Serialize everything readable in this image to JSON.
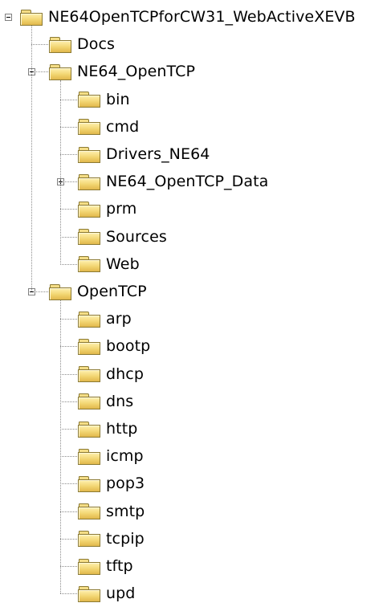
{
  "tree": {
    "root": {
      "label": "NE64OpenTCPforCW31_WebActiveXEVB",
      "expanded": true,
      "children": [
        {
          "label": "Docs"
        },
        {
          "label": "NE64_OpenTCP",
          "expanded": true,
          "children": [
            {
              "label": "bin"
            },
            {
              "label": "cmd"
            },
            {
              "label": "Drivers_NE64"
            },
            {
              "label": "NE64_OpenTCP_Data",
              "expanded": false,
              "has_children": true
            },
            {
              "label": "prm"
            },
            {
              "label": "Sources"
            },
            {
              "label": "Web"
            }
          ]
        },
        {
          "label": "OpenTCP",
          "expanded": true,
          "children": [
            {
              "label": "arp"
            },
            {
              "label": "bootp"
            },
            {
              "label": "dhcp"
            },
            {
              "label": "dns"
            },
            {
              "label": "http"
            },
            {
              "label": "icmp"
            },
            {
              "label": "pop3"
            },
            {
              "label": "smtp"
            },
            {
              "label": "tcpip"
            },
            {
              "label": "tftp"
            },
            {
              "label": "upd"
            }
          ]
        }
      ]
    }
  },
  "icons": {
    "folder": "folder-icon",
    "expand": "plus-box-icon",
    "collapse": "minus-box-icon"
  },
  "colors": {
    "folder_fill": "#f2d571",
    "folder_outline": "#8c7a33",
    "connector": "#8c8c8c"
  }
}
